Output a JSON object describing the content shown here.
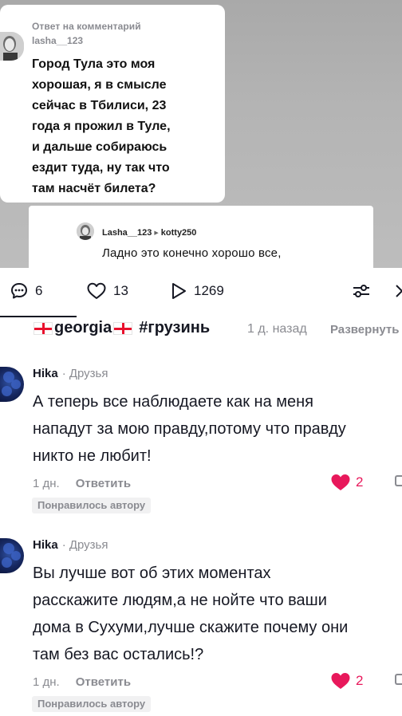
{
  "reply_card": {
    "header": "Ответ на комментарий",
    "username": "lasha__123",
    "text": "Город Тула это моя\nхорошая, я в смысле\nсейчас в Тбилиси, 23\nгода я прожил в Туле,\nи дальше собираюсь\nездит туда, ну так что\nтам насчёт билета?"
  },
  "sub_card": {
    "username": "Lasha__123",
    "reply_to": "kotty250",
    "text": "Ладно это конечно хорошо все,"
  },
  "actions": {
    "comments": "6",
    "likes": "13",
    "views": "1269"
  },
  "caption": {
    "tag1": "georgia",
    "tag2": "#грузинь",
    "time": "1 д. назад",
    "expand": "Развернуть"
  },
  "comments": [
    {
      "author": "Hika",
      "relation": "· Друзья",
      "lines": [
        "А теперь все наблюдаете как на меня",
        "нападут за мою правду,потому что правду",
        "никто не любит!"
      ],
      "time": "1 дн.",
      "reply": "Ответить",
      "likes": "2",
      "badge": "Понравилось автору"
    },
    {
      "author": "Hika",
      "relation": "· Друзья",
      "lines": [
        "Вы лучше вот об этих моментах",
        "расскажите людям,а не нойте что ваши",
        "дома в Сухуми,лучше скажите почему они",
        "там без вас остались!?"
      ],
      "time": "1 дн.",
      "reply": "Ответить",
      "likes": "2",
      "badge": "Понравилось автору"
    }
  ],
  "colors": {
    "like": "#e8185b",
    "muted": "#8a8b91",
    "flag_red": "#e8112d"
  },
  "icons": [
    "comment-icon",
    "heart-icon",
    "play-icon",
    "filter-icon",
    "close-icon",
    "georgia-flag-icon",
    "heart-filled-icon",
    "more-icon"
  ]
}
